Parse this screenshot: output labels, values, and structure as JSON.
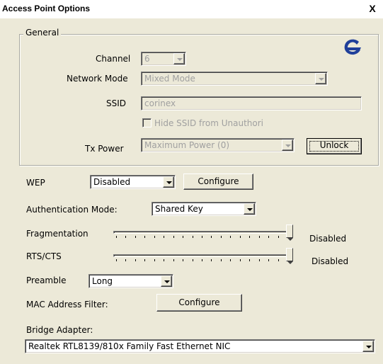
{
  "window": {
    "title": "Access Point Options",
    "close_label": "X"
  },
  "general": {
    "legend": "General",
    "channel": {
      "label": "Channel",
      "value": "6"
    },
    "network_mode": {
      "label": "Network Mode",
      "value": "Mixed Mode"
    },
    "ssid": {
      "label": "SSID",
      "value": "corinex"
    },
    "hide_ssid": {
      "label": "Hide SSID from Unauthori",
      "checked": false
    },
    "tx_power": {
      "label": "Tx Power",
      "value": "Maximum Power (0)"
    },
    "unlock_label": "Unlock"
  },
  "wep": {
    "label": "WEP",
    "value": "Disabled",
    "configure_label": "Configure"
  },
  "auth": {
    "label": "Authentication Mode:",
    "value": "Shared Key"
  },
  "fragmentation": {
    "label": "Fragmentation",
    "status": "Disabled",
    "level": 1.0
  },
  "rts_cts": {
    "label": "RTS/CTS",
    "status": "Disabled",
    "level": 1.0
  },
  "preamble": {
    "label": "Preamble",
    "value": "Long"
  },
  "mac_filter": {
    "label": "MAC Address Filter:",
    "configure_label": "Configure"
  },
  "bridge": {
    "label": "Bridge Adapter:",
    "value": "Realtek RTL8139/810x Family Fast Ethernet NIC"
  },
  "colors": {
    "logo_blue": "#1f3f9a",
    "dialog_bg": "#ece9d8"
  },
  "icons": {
    "logo": "corinex-logo-icon",
    "close": "close-icon"
  }
}
